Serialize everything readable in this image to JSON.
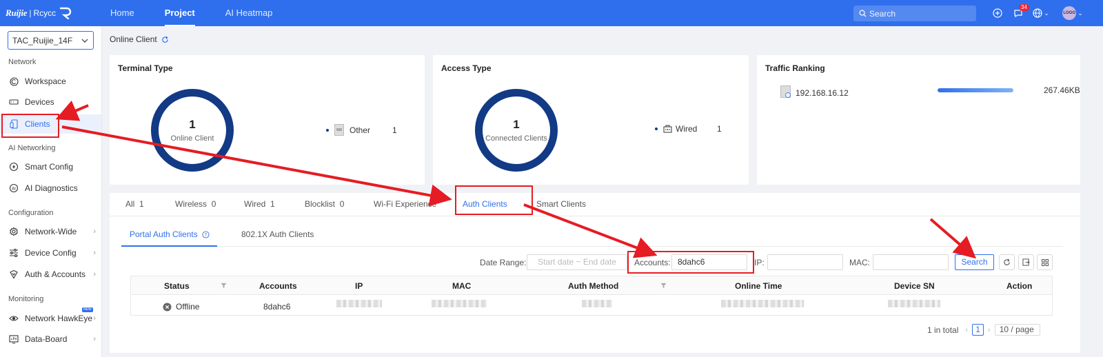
{
  "topbar": {
    "logo_brand": "Ruijie",
    "logo_sub": "Rcycc",
    "nav": [
      "Home",
      "Project",
      "AI Heatmap"
    ],
    "active_nav": "Project",
    "search_placeholder": "Search",
    "notification_count": "34",
    "avatar_text": "LOGO"
  },
  "sidebar": {
    "project": "TAC_Ruijie_14F",
    "groups": {
      "network": "Network",
      "ai_networking": "AI Networking",
      "configuration": "Configuration",
      "monitoring": "Monitoring"
    },
    "items": {
      "workspace": "Workspace",
      "devices": "Devices",
      "clients": "Clients",
      "smart_config": "Smart Config",
      "ai_diagnostics": "AI Diagnostics",
      "network_wide": "Network-Wide",
      "device_config": "Device Config",
      "auth_accounts": "Auth & Accounts",
      "network_hawkeye": "Network HawkEye",
      "data_board": "Data-Board"
    },
    "new_tag": "NEW"
  },
  "breadcrumb": "Online Client",
  "terminal_type": {
    "title": "Terminal Type",
    "count": "1",
    "label": "Online Client",
    "legend_name": "Other",
    "legend_count": "1"
  },
  "access_type": {
    "title": "Access Type",
    "count": "1",
    "label": "Connected Clients",
    "legend_name": "Wired",
    "legend_count": "1"
  },
  "traffic": {
    "title": "Traffic Ranking",
    "ip": "192.168.16.12",
    "value": "267.46KB",
    "fill_fraction": 1.0
  },
  "tabs": {
    "all": {
      "label": "All",
      "count": "1"
    },
    "wireless": {
      "label": "Wireless",
      "count": "0"
    },
    "wired": {
      "label": "Wired",
      "count": "1"
    },
    "blocklist": {
      "label": "Blocklist",
      "count": "0"
    },
    "wifi": {
      "label": "Wi-Fi Experience"
    },
    "auth": {
      "label": "Auth Clients"
    },
    "smart": {
      "label": "Smart Clients"
    }
  },
  "subtabs": {
    "portal": "Portal Auth Clients",
    "dot1x": "802.1X Auth Clients"
  },
  "filters": {
    "date_label": "Date Range:",
    "start_placeholder": "Start date",
    "sep": "~",
    "end_placeholder": "End date",
    "accounts_label": "Accounts:",
    "accounts_value": "8dahc6",
    "ip_label": "IP:",
    "mac_label": "MAC:",
    "search_btn": "Search"
  },
  "table": {
    "headers": {
      "status": "Status",
      "accounts": "Accounts",
      "ip": "IP",
      "mac": "MAC",
      "auth_method": "Auth Method",
      "online_time": "Online Time",
      "device_sn": "Device SN",
      "action": "Action"
    },
    "row": {
      "status": "Offline",
      "accounts": "8dahc6"
    }
  },
  "pager": {
    "total": "1 in total",
    "page": "1",
    "size": "10 / page"
  },
  "colors": {
    "brand": "#2f6fed",
    "donut": "#123a85",
    "annotation": "#e51c23"
  }
}
